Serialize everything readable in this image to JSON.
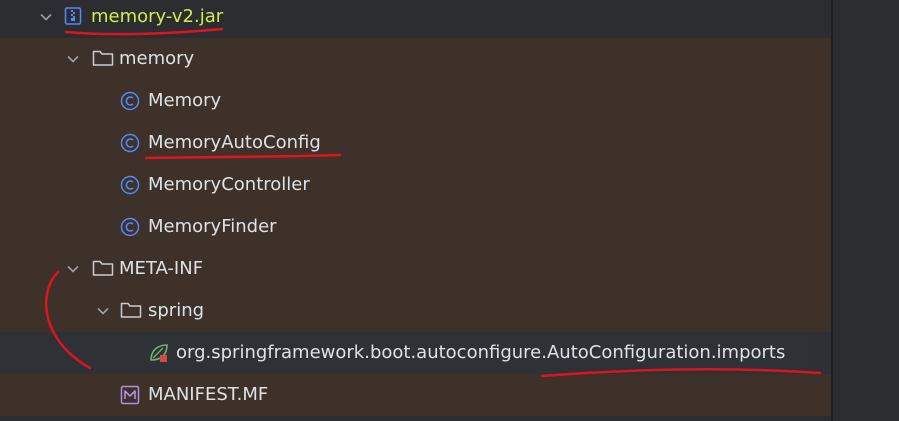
{
  "tree": {
    "items": [
      {
        "label": "memory-v2.jar",
        "icon": "jar-archive-icon",
        "expanded": true
      },
      {
        "label": "memory",
        "icon": "folder-icon",
        "expanded": true
      },
      {
        "label": "Memory",
        "icon": "java-class-icon"
      },
      {
        "label": "MemoryAutoConfig",
        "icon": "java-class-icon"
      },
      {
        "label": "MemoryController",
        "icon": "java-class-icon"
      },
      {
        "label": "MemoryFinder",
        "icon": "java-class-icon"
      },
      {
        "label": "META-INF",
        "icon": "folder-icon",
        "expanded": true
      },
      {
        "label": "spring",
        "icon": "folder-icon",
        "expanded": true
      },
      {
        "label": "org.springframework.boot.autoconfigure.AutoConfiguration.imports",
        "icon": "spring-imports-file-icon",
        "selected": true
      },
      {
        "label": "MANIFEST.MF",
        "icon": "manifest-file-icon"
      }
    ]
  },
  "colors": {
    "background": "#2b2d30",
    "row_highlight": "#3d3129",
    "selected_row": "#2e3136",
    "jar_label": "#d5e94f",
    "text": "#dfe1e5",
    "annotation": "#e0141e",
    "class_icon": "#548af7"
  }
}
